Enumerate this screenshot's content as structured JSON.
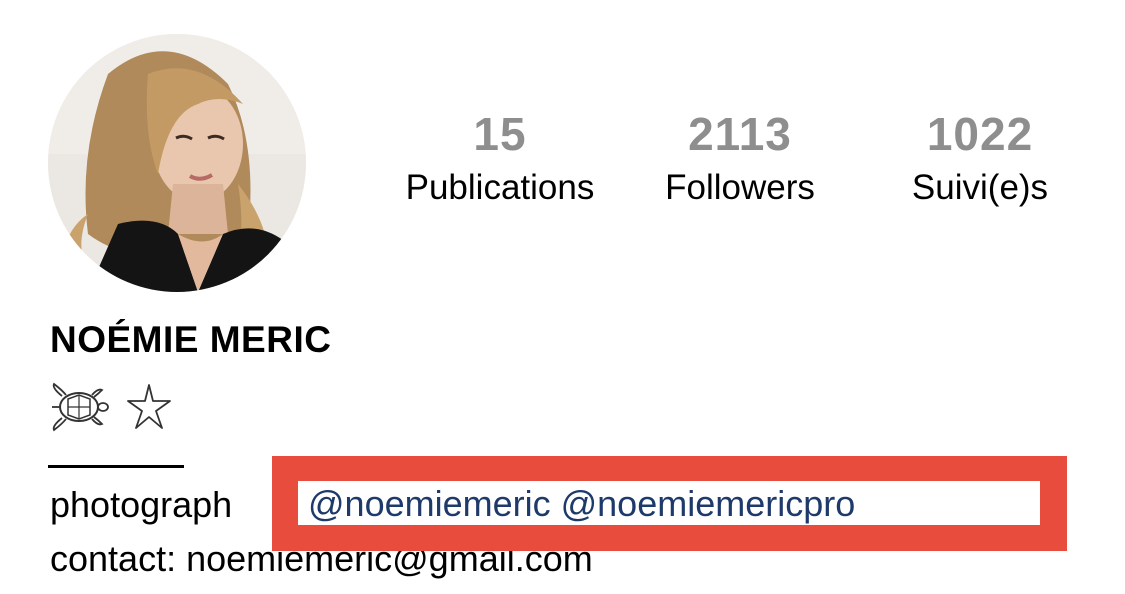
{
  "profile": {
    "name": "NOÉMIE MERIC",
    "avatar_icon": "profile-photo",
    "stats": [
      {
        "value": "15",
        "label": "Publications"
      },
      {
        "value": "2113",
        "label": "Followers"
      },
      {
        "value": "1022",
        "label": "Suivi(e)s"
      }
    ],
    "bio": {
      "emojis": [
        "turtle-icon",
        "starfish-icon"
      ],
      "line1_prefix": "photograph",
      "mentions": "@noemiemeric @noemiemericpro",
      "line2": "contact: noemiemeric@gmail.com"
    }
  },
  "colors": {
    "stat_number": "#8e8e8e",
    "mention": "#1e3a6b",
    "highlight": "#e84c3d"
  }
}
